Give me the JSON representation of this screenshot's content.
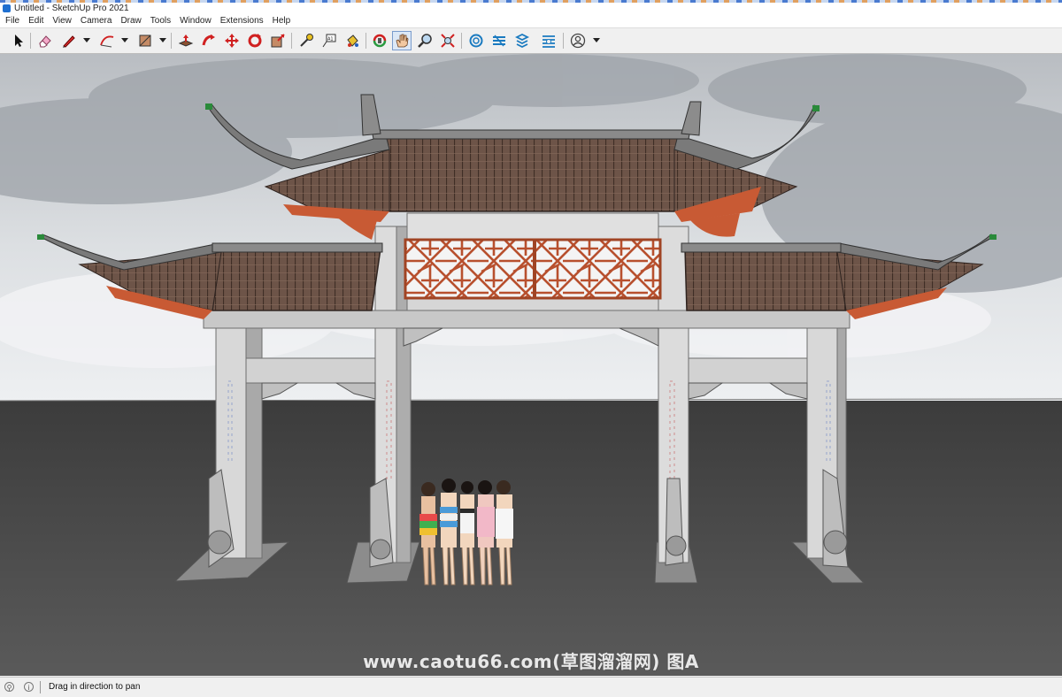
{
  "window": {
    "title": "Untitled - SketchUp Pro 2021"
  },
  "menu": [
    "File",
    "Edit",
    "View",
    "Camera",
    "Draw",
    "Tools",
    "Window",
    "Extensions",
    "Help"
  ],
  "toolbar": {
    "tools": [
      "select-icon",
      "eraser-icon",
      "pencil-line-icon",
      "arc-icon",
      "rectangle-shape-icon",
      "push-pull-icon",
      "follow-me-icon",
      "move-icon",
      "rotate-icon",
      "scale-icon",
      "tape-measure-icon",
      "text-tag-icon",
      "paint-bucket-icon",
      "orbit-icon",
      "pan-hand-icon",
      "zoom-icon",
      "zoom-extents-icon",
      "warehouse-icon",
      "extension-warehouse-icon",
      "layout-icon",
      "extension-manager-icon",
      "account-icon"
    ],
    "active": "pan-hand-icon"
  },
  "watermark": "www.caotu66.com(草图溜溜网) 图A",
  "status": {
    "message": "Drag in direction to pan"
  }
}
